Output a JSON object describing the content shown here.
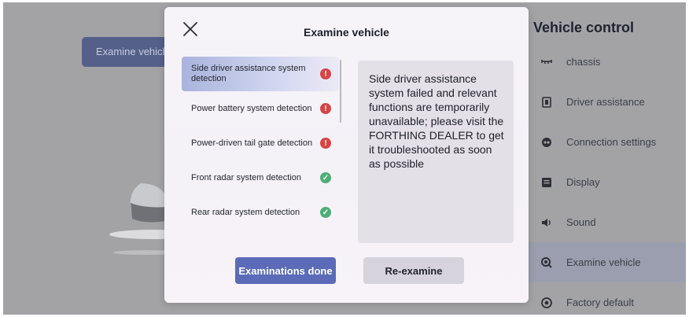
{
  "background": {
    "examine_button_label": "Examine vehicle",
    "sidebar": {
      "title": "Vehicle control",
      "items": [
        {
          "label": "chassis",
          "icon": "chassis-icon"
        },
        {
          "label": "Driver assistance",
          "icon": "driver-assistance-icon"
        },
        {
          "label": "Connection settings",
          "icon": "connection-icon"
        },
        {
          "label": "Display",
          "icon": "display-icon"
        },
        {
          "label": "Sound",
          "icon": "sound-icon"
        },
        {
          "label": "Examine vehicle",
          "icon": "examine-icon",
          "active": true
        },
        {
          "label": "Factory default",
          "icon": "factory-default-icon"
        }
      ]
    }
  },
  "modal": {
    "title": "Examine vehicle",
    "detections": [
      {
        "label": "Side driver assistance system detection",
        "status": "error"
      },
      {
        "label": "Power battery system detection",
        "status": "error"
      },
      {
        "label": "Power-driven tail gate detection",
        "status": "error"
      },
      {
        "label": "Front radar system detection",
        "status": "ok"
      },
      {
        "label": "Rear radar system detection",
        "status": "ok"
      }
    ],
    "message": "Side driver assistance system failed and relevant functions are temporarily unavailable; please visit the FORTHING DEALER to get it troubleshooted as soon as possible",
    "buttons": {
      "done": "Examinations done",
      "reexamine": "Re-examine"
    }
  },
  "colors": {
    "accent": "#5b6bb8",
    "error": "#d64545",
    "ok": "#4caf74"
  }
}
